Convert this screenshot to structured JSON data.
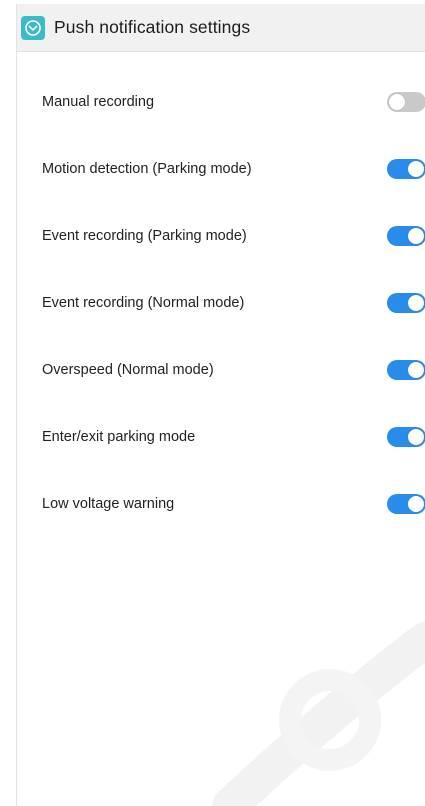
{
  "header": {
    "title": "Push notification settings",
    "icon": "app-logo-icon"
  },
  "colors": {
    "accent": "#2a8cea",
    "toggle_off": "#c9c9c9",
    "app_icon": "#3bbcc4"
  },
  "settings": [
    {
      "label": "Manual recording",
      "enabled": false
    },
    {
      "label": "Motion detection (Parking mode)",
      "enabled": true
    },
    {
      "label": "Event recording (Parking mode)",
      "enabled": true
    },
    {
      "label": "Event recording (Normal mode)",
      "enabled": true
    },
    {
      "label": "Overspeed (Normal mode)",
      "enabled": true
    },
    {
      "label": "Enter/exit parking mode",
      "enabled": true
    },
    {
      "label": "Low voltage warning",
      "enabled": true
    }
  ]
}
